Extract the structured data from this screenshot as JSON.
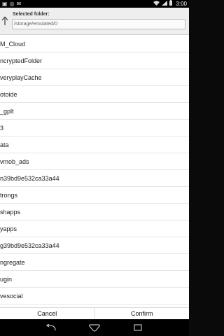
{
  "status_bar": {
    "time": "3:00",
    "left_icons": [
      "image-icon",
      "record-icon",
      "mail-icon"
    ],
    "right_icons": [
      "wifi-icon",
      "signal-icon",
      "battery-icon"
    ]
  },
  "dialog": {
    "title": "Selected folder:",
    "path": "/storage/emulated/0",
    "folders": [
      "M_Cloud",
      "ncryptedFolder",
      "veryplayCache",
      "otoide",
      "_gplt",
      "3",
      "ata",
      "vmob_ads",
      "n39bd9e532ca33a44",
      "trongs",
      "shapps",
      "yapps",
      "g39bd9e532ca33a44",
      "ngregate",
      "ugin",
      "vesocial"
    ],
    "cancel_label": "Cancel",
    "confirm_label": "Confirm"
  },
  "nav_bar": {
    "buttons": [
      "back-icon",
      "home-icon",
      "recents-icon"
    ]
  }
}
